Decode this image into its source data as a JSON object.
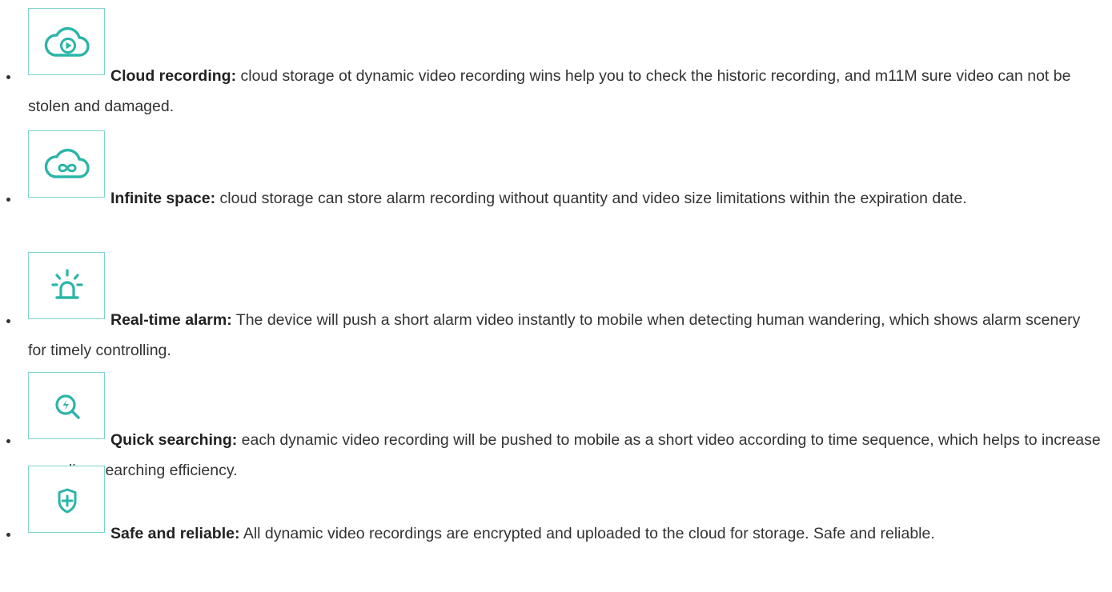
{
  "features": [
    {
      "icon": "cloud-play-icon",
      "title": "Cloud recording:",
      "text": " cloud storage ot dynamic video recording wins help you to check the historic recording, and m11M sure video can not be stolen and damaged."
    },
    {
      "icon": "cloud-infinity-icon",
      "title": "Infinite space:",
      "text": " cloud storage can store alarm recording without quantity and video size limitations within the expiration date."
    },
    {
      "icon": "alarm-siren-icon",
      "title": "Real-time alarm:",
      "text": " The device will push a short alarm video instantly to mobile when detecting human wandering, which shows alarm scenery for timely controlling."
    },
    {
      "icon": "quick-search-icon",
      "title": "Quick searching:",
      "text": " each dynamic video recording will be pushed to mobile as a short video according to time sequence, which helps to increase recording searching efficiency."
    },
    {
      "icon": "shield-plus-icon",
      "title": "Safe and reliable:",
      "text": " All dynamic video recordings are encrypted and uploaded to the cloud for storage. Safe and reliable."
    }
  ],
  "colors": {
    "accent": "#2bb5a8",
    "box_border": "#7ed4cc",
    "text": "#333333"
  }
}
